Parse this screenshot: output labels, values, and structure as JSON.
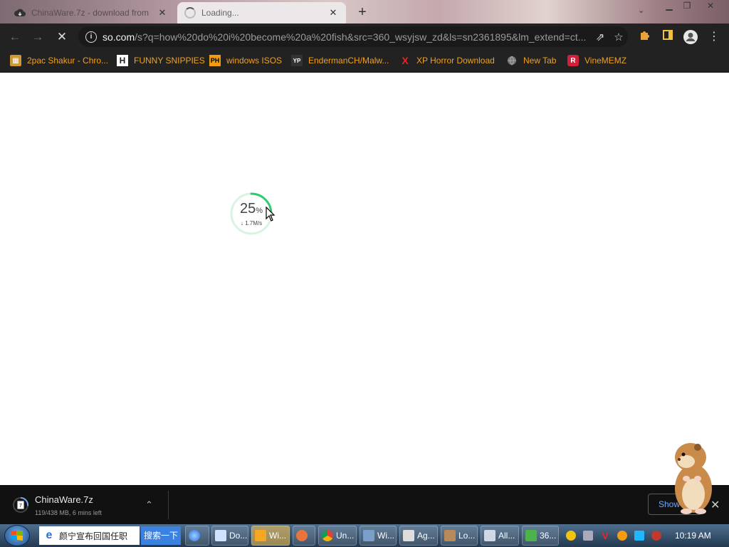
{
  "browser": {
    "tabs": [
      {
        "title": "ChinaWare.7z - download from",
        "icon": "cloud-download-icon"
      },
      {
        "title": "Loading...",
        "icon": "loading-spinner-icon"
      }
    ],
    "new_tab_label": "+",
    "close_glyph": "✕",
    "url_host": "so.com",
    "url_rest": "/s?q=how%20do%20i%20become%20a%20fish&src=360_wsyjsw_zd&ls=sn2361895&lm_extend=ct..."
  },
  "bookmarks": [
    {
      "label": "2pac Shakur - Chro...",
      "icon": "puzzle-icon",
      "icon_text": "🧩"
    },
    {
      "label": "FUNNY SNIPPIES",
      "icon": "h-icon",
      "icon_text": "H"
    },
    {
      "label": "windows ISOS",
      "icon": "ph-icon",
      "icon_text": "PH"
    },
    {
      "label": "EndermanCH/Malw...",
      "icon": "yp-icon",
      "icon_text": "YP"
    },
    {
      "label": "XP Horror Download",
      "icon": "x-icon",
      "icon_text": "X"
    },
    {
      "label": "New Tab",
      "icon": "globe-icon",
      "icon_text": "🌐"
    },
    {
      "label": "VineMEMZ",
      "icon": "r-icon",
      "icon_text": "R"
    }
  ],
  "page": {
    "progress": {
      "percent": 25,
      "percent_text": "25",
      "percent_sign": "%",
      "speed": "↓ 1.7M/s"
    }
  },
  "download": {
    "filename": "ChinaWare.7z",
    "status": "119/438 MB, 6 mins left",
    "progress_fraction": 0.27,
    "show_all_label": "Show all"
  },
  "taskbar": {
    "search_text": "颜宁宣布回国任职",
    "search_button": "搜索一下",
    "buttons": [
      {
        "label": "",
        "icon": "ie-icon"
      },
      {
        "label": "Do...",
        "icon": "document-icon"
      },
      {
        "label": "Wi...",
        "icon": "media-player-icon"
      },
      {
        "label": "",
        "icon": "app-icon"
      },
      {
        "label": "Un...",
        "icon": "chrome-icon"
      },
      {
        "label": "Wi...",
        "icon": "window-icon"
      },
      {
        "label": "Ag...",
        "icon": "agent-icon"
      },
      {
        "label": "Lo...",
        "icon": "lock-icon"
      },
      {
        "label": "All...",
        "icon": "folder-icon"
      },
      {
        "label": "36...",
        "icon": "security-icon"
      }
    ],
    "time": "10:19 AM"
  },
  "colors": {
    "accent_green": "#2ecc71",
    "bookmark_text": "#f0a020",
    "link_blue": "#6ea8ff"
  }
}
